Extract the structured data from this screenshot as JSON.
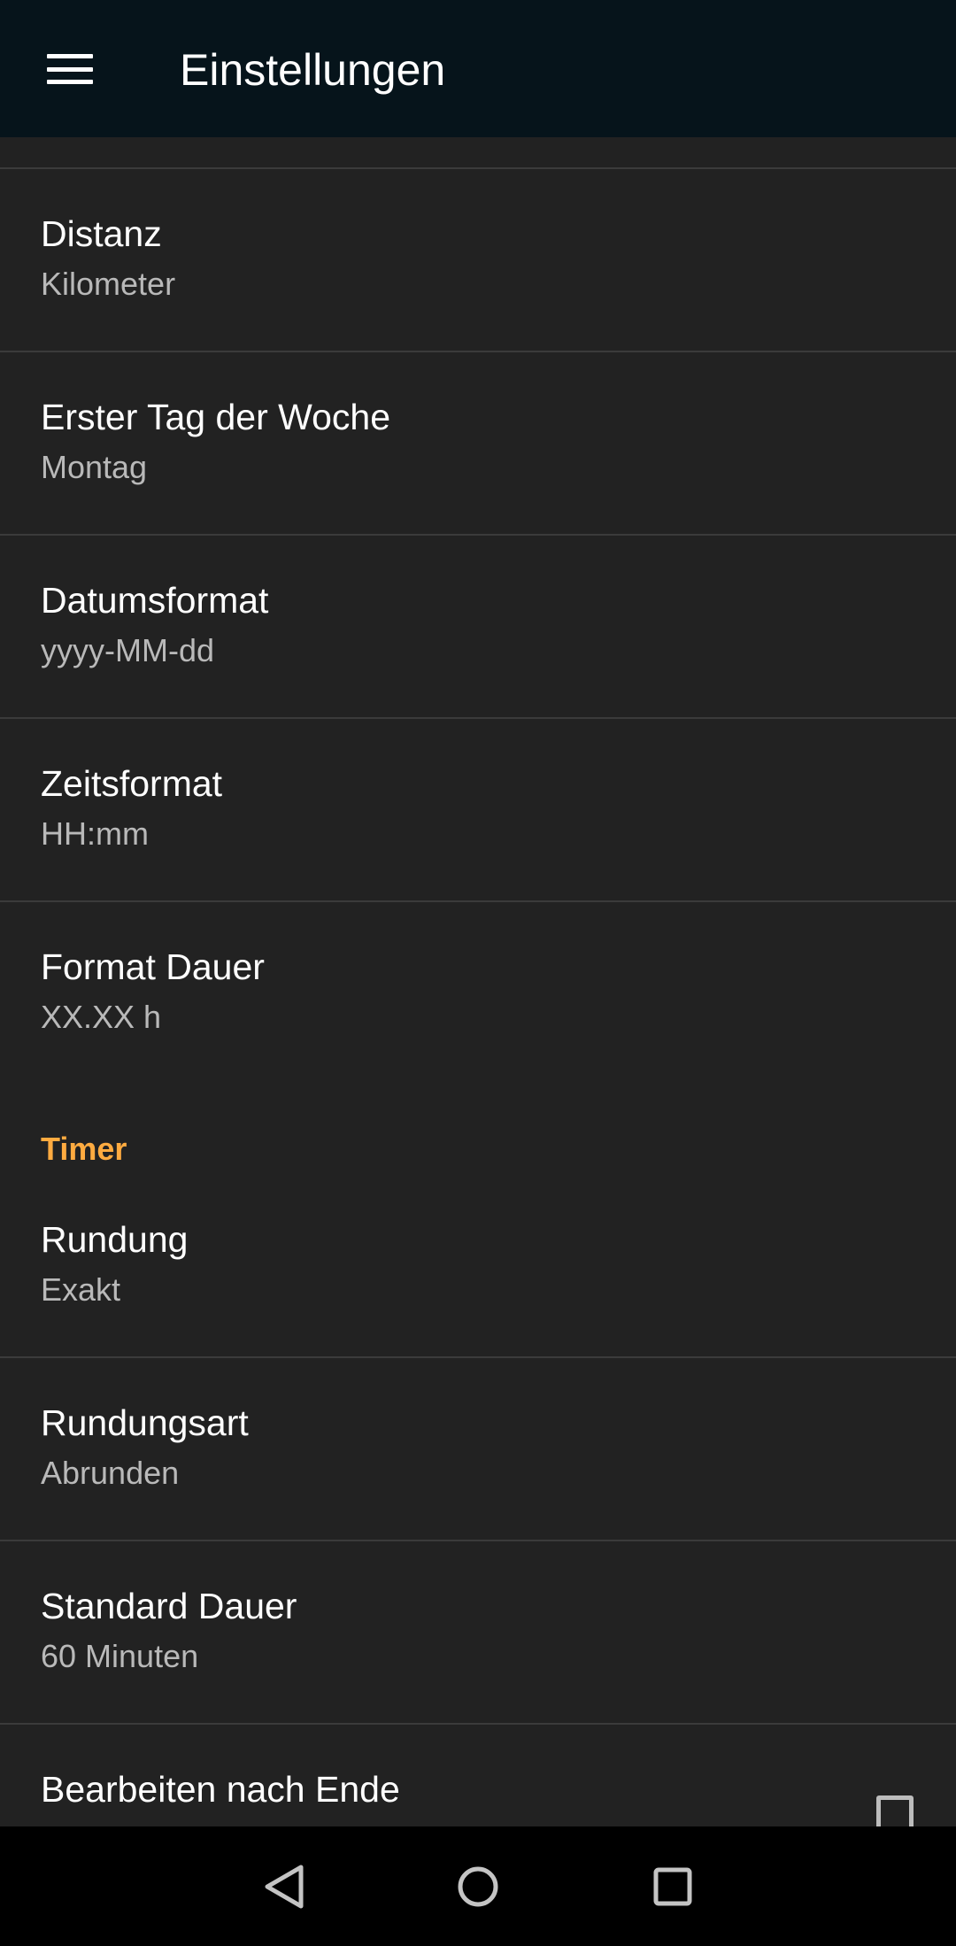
{
  "appbar": {
    "title": "Einstellungen",
    "menu_icon": "hamburger-menu-icon"
  },
  "items": [
    {
      "title": "Distanz",
      "summary": "Kilometer"
    },
    {
      "title": "Erster Tag der Woche",
      "summary": "Montag"
    },
    {
      "title": "Datumsformat",
      "summary": "yyyy-MM-dd"
    },
    {
      "title": "Zeitsformat",
      "summary": "HH:mm"
    },
    {
      "title": "Format Dauer",
      "summary": "XX.XX h"
    }
  ],
  "timer": {
    "category": "Timer",
    "items": [
      {
        "title": "Rundung",
        "summary": "Exakt"
      },
      {
        "title": "Rundungsart",
        "summary": "Abrunden"
      },
      {
        "title": "Standard Dauer",
        "summary": "60 Minuten"
      },
      {
        "title": "Bearbeiten nach Ende",
        "checked": false
      }
    ]
  },
  "navbar": {
    "back_icon": "back-triangle-icon",
    "home_icon": "home-circle-icon",
    "recents_icon": "recents-square-icon"
  },
  "colors": {
    "appbar": "#06141b",
    "background": "#222222",
    "accent": "#ffab40",
    "divider": "#3b3b3b"
  }
}
